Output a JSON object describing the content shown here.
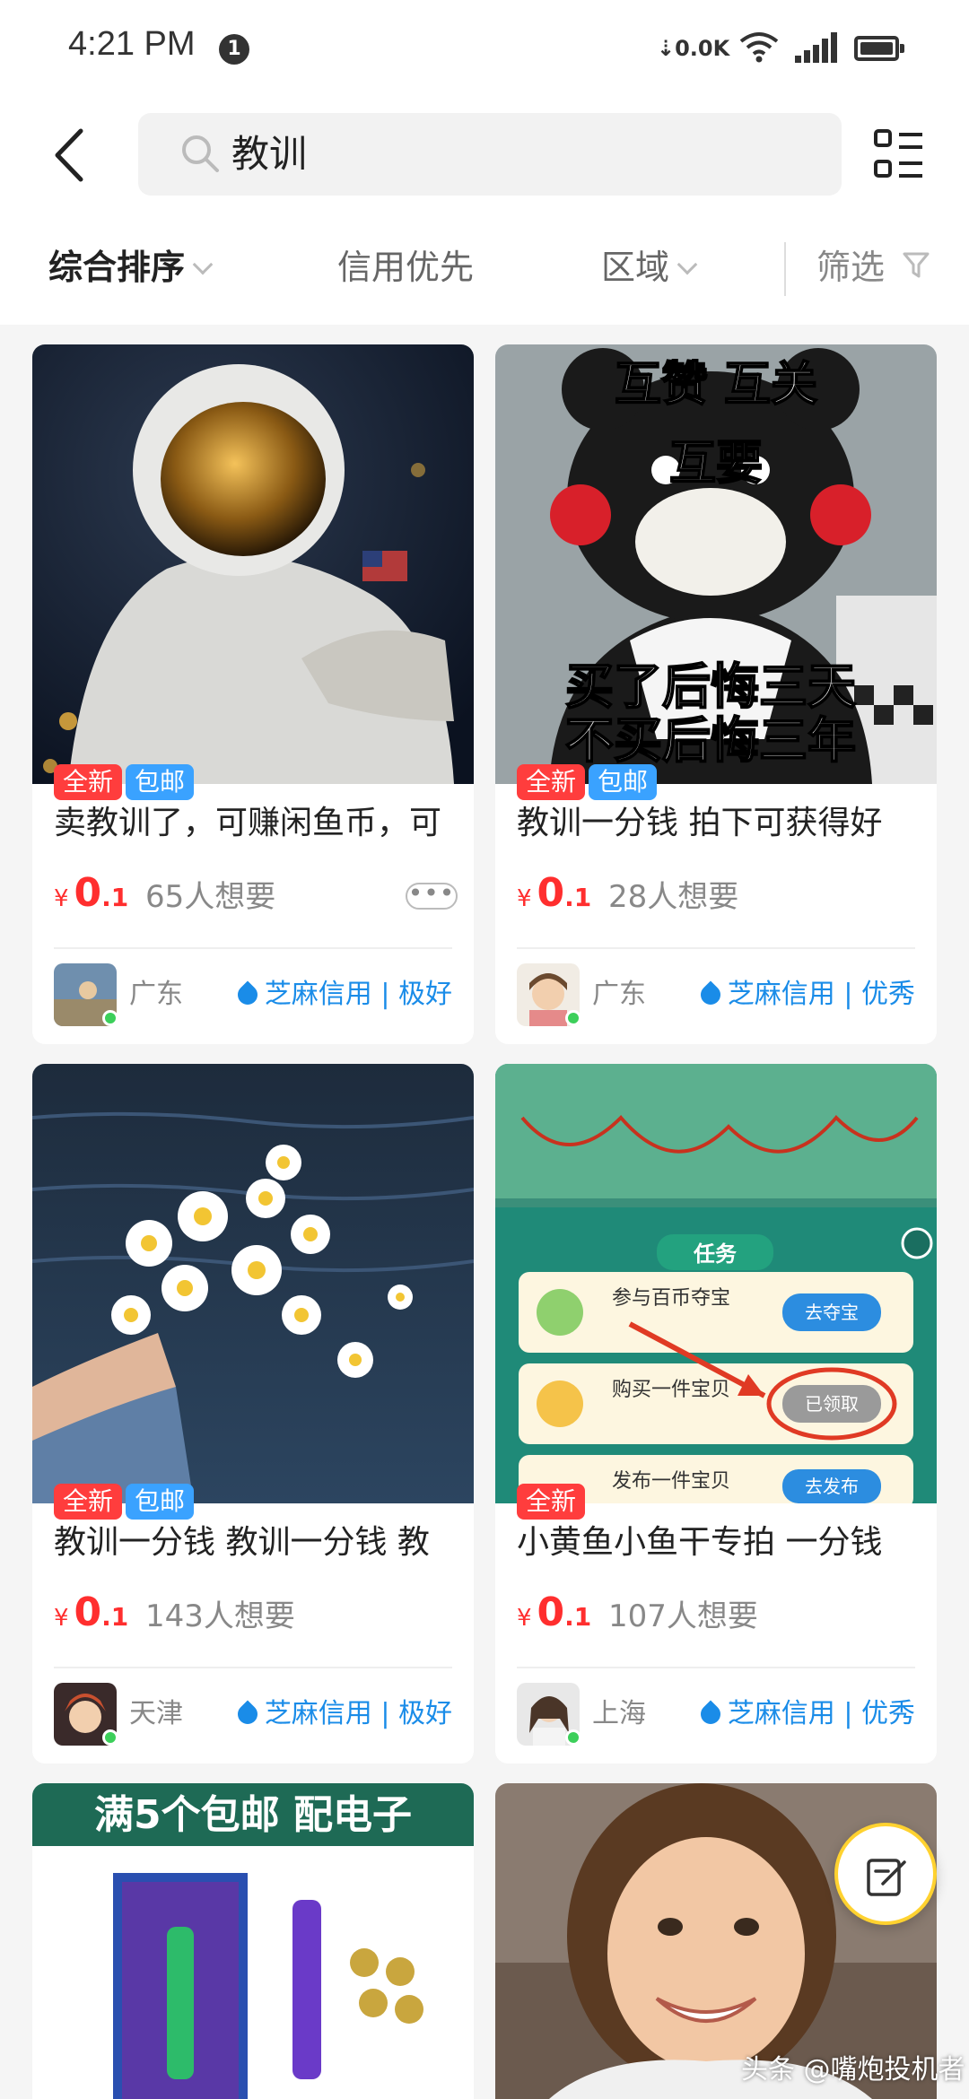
{
  "status_bar": {
    "time": "4:21 PM",
    "notification_count": "1",
    "net_speed": "0.0K"
  },
  "header": {
    "search_query": "教训",
    "back_icon": "chevron-left-icon",
    "layout_icon": "list-grid-icon"
  },
  "filters": {
    "sort": "综合排序",
    "credit_first": "信用优先",
    "region": "区域",
    "filter": "筛选"
  },
  "products": [
    {
      "image": "astronaut-photo",
      "badges": [
        "全新",
        "包邮"
      ],
      "title": "卖教训了，可赚闲鱼币，可",
      "price_symbol": "¥",
      "price_int": "0",
      "price_dec": ".1",
      "wants": "65人想要",
      "more": "•••",
      "city": "广东",
      "credit": "芝麻信用 | 极好"
    },
    {
      "image": "kumamon-meme",
      "image_text": [
        "互赞 互关",
        "互要",
        "买了后悔三天",
        "不买后悔三年"
      ],
      "badges": [
        "全新",
        "包邮"
      ],
      "title": "教训一分钱 拍下可获得好",
      "price_symbol": "¥",
      "price_int": "0",
      "price_dec": ".1",
      "wants": "28人想要",
      "city": "广东",
      "credit": "芝麻信用 | 优秀"
    },
    {
      "image": "daisies-over-water",
      "badges": [
        "全新",
        "包邮"
      ],
      "title": "教训一分钱 教训一分钱 教",
      "price_symbol": "¥",
      "price_int": "0",
      "price_dec": ".1",
      "wants": "143人想要",
      "city": "天津",
      "credit": "芝麻信用 | 极好"
    },
    {
      "image": "game-task-screenshot",
      "image_text": [
        "任务",
        "参与百币夺宝",
        "去夺宝",
        "购买一件宝贝",
        "已领取",
        "发布一件宝贝",
        "去发布"
      ],
      "badges": [
        "全新"
      ],
      "title": "小黄鱼小鱼干专拍 一分钱",
      "price_symbol": "¥",
      "price_int": "0",
      "price_dec": ".1",
      "wants": "107人想要",
      "city": "上海",
      "credit": "芝麻信用 | 优秀"
    },
    {
      "image": "laser-pointer-product",
      "image_text": [
        "满5个包邮 配电子"
      ]
    },
    {
      "image": "smiling-girl-photo"
    }
  ],
  "fab": {
    "icon": "edit-note-icon"
  },
  "watermark": "头条 @嘴炮投机者"
}
